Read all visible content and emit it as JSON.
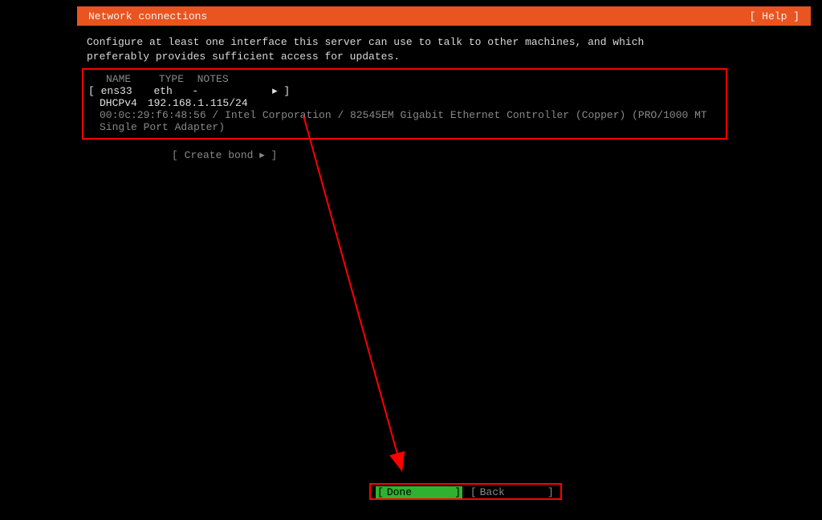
{
  "header": {
    "title": "Network connections",
    "help": "[ Help ]"
  },
  "description": "Configure at least one interface this server can use to talk to other machines, and which preferably provides sufficient access for updates.",
  "table": {
    "headers": {
      "name": "NAME",
      "type": "TYPE",
      "notes": "NOTES"
    }
  },
  "interface": {
    "open_bracket": "[",
    "name": "ens33",
    "type": "eth",
    "notes": "-",
    "arrow": "▸",
    "close_bracket": "]",
    "dhcp_label": "DHCPv4",
    "dhcp_value": "192.168.1.115/24",
    "mac_info": "00:0c:29:f6:48:56 / Intel Corporation / 82545EM Gigabit Ethernet Controller (Copper) (PRO/1000 MT Single Port Adapter)"
  },
  "create_bond": "[ Create bond ▸ ]",
  "buttons": {
    "done_open": "[",
    "done": "Done",
    "done_close": "]",
    "back_open": "[",
    "back": "Back",
    "back_close": "]"
  }
}
